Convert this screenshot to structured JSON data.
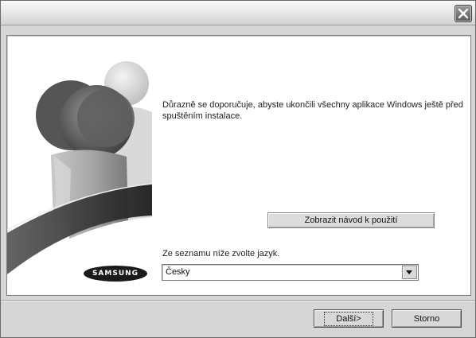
{
  "window": {
    "close_icon": "close-x-icon"
  },
  "content": {
    "message": "Důrazně se doporučuje, abyste ukončili všechny aplikace Windows ještě před spuštěním instalace.",
    "guide_button_label": "Zobrazit návod k použití",
    "language_label": "Ze seznamu níže zvolte jazyk.",
    "language_selected": "Česky",
    "logo_text": "SAMSUNG"
  },
  "footer": {
    "next_label": "Další>",
    "cancel_label": "Storno"
  }
}
